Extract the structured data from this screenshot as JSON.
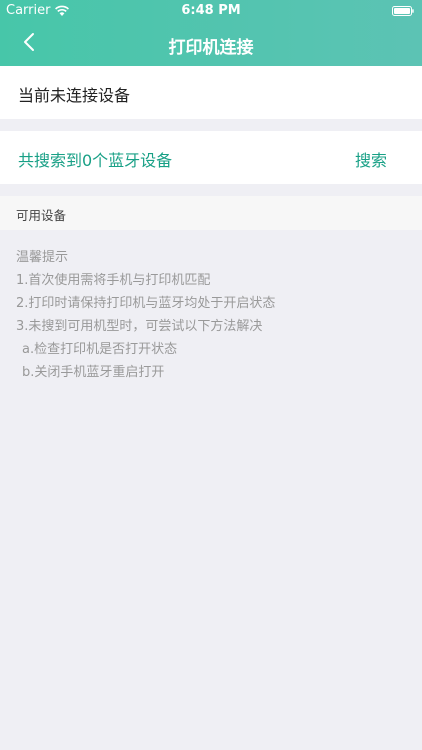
{
  "status_bar": {
    "carrier": "Carrier",
    "time": "6:48 PM",
    "wifi_icon": "wifi-icon",
    "battery_icon": "battery-icon"
  },
  "nav": {
    "title": "打印机连接",
    "back_icon": "chevron-left-icon"
  },
  "connection": {
    "status": "当前未连接设备"
  },
  "search": {
    "result_text": "共搜索到0个蓝牙设备",
    "button_label": "搜索"
  },
  "devices_section": {
    "title": "可用设备"
  },
  "tips": {
    "title": "温馨提示",
    "lines": [
      "1.首次使用需将手机与打印机匹配",
      "2.打印时请保持打印机与蓝牙均处于开启状态",
      "3.未搜到可用机型时，可尝试以下方法解决",
      "a.检查打印机是否打开状态",
      "b.关闭手机蓝牙重启打开"
    ]
  },
  "colors": {
    "header": "#4fc5ad",
    "accent_text": "#18a086",
    "background": "#efeff4",
    "tip_text": "#999999"
  }
}
